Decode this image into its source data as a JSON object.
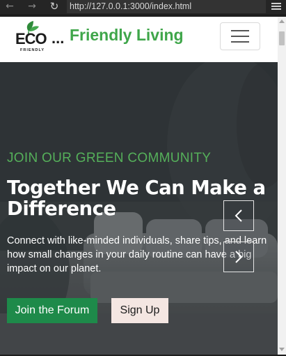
{
  "browser": {
    "url": "http://127.0.0.1:3000/index.html",
    "back_icon": "arrow-left-icon",
    "forward_icon": "arrow-right-icon",
    "reload_icon": "reload-icon",
    "menu_icon": "hamburger-icon"
  },
  "navbar": {
    "logo": {
      "word": "ECO",
      "tagline": "FRIENDLY"
    },
    "brand_ellipsis": "...",
    "brand_text": "Friendly Living",
    "toggler_icon": "hamburger-icon"
  },
  "hero": {
    "eyebrow": "JOIN OUR GREEN COMMUNITY",
    "headline": "Together We Can Make a Difference",
    "lead": "Connect with like-minded individuals, share tips, and learn how small changes in your daily routine can have a big impact on our planet.",
    "primary_button": "Join the Forum",
    "secondary_button": "Sign Up",
    "prev_icon": "chevron-left-icon",
    "next_icon": "chevron-right-icon"
  },
  "colors": {
    "brand_green": "#3fa64a",
    "eyebrow_green": "#55b05a",
    "button_green": "#1e8a4a",
    "button_light": "#f4e6e2"
  }
}
